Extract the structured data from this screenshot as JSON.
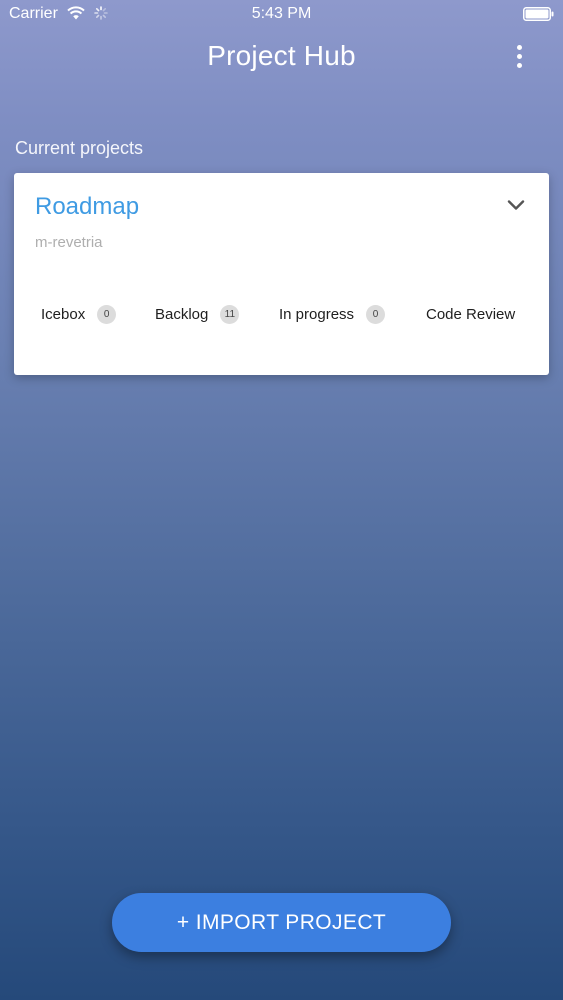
{
  "status_bar": {
    "carrier": "Carrier",
    "time": "5:43 PM"
  },
  "app_bar": {
    "title": "Project Hub",
    "menu_icon": "more-vertical-icon"
  },
  "section": {
    "title": "Current projects"
  },
  "project": {
    "name": "Roadmap",
    "owner": "m-revetria",
    "expand_icon": "chevron-down-icon",
    "lanes": [
      {
        "label": "Icebox",
        "count": "0"
      },
      {
        "label": "Backlog",
        "count": "11"
      },
      {
        "label": "In progress",
        "count": "0"
      },
      {
        "label": "Code Review",
        "count": ""
      }
    ]
  },
  "actions": {
    "import_label": "+ IMPORT PROJECT"
  },
  "colors": {
    "accent": "#3c7fe0",
    "project_name": "#3f9be3",
    "background_top": "#8e99cc",
    "background_bottom": "#25497a"
  }
}
